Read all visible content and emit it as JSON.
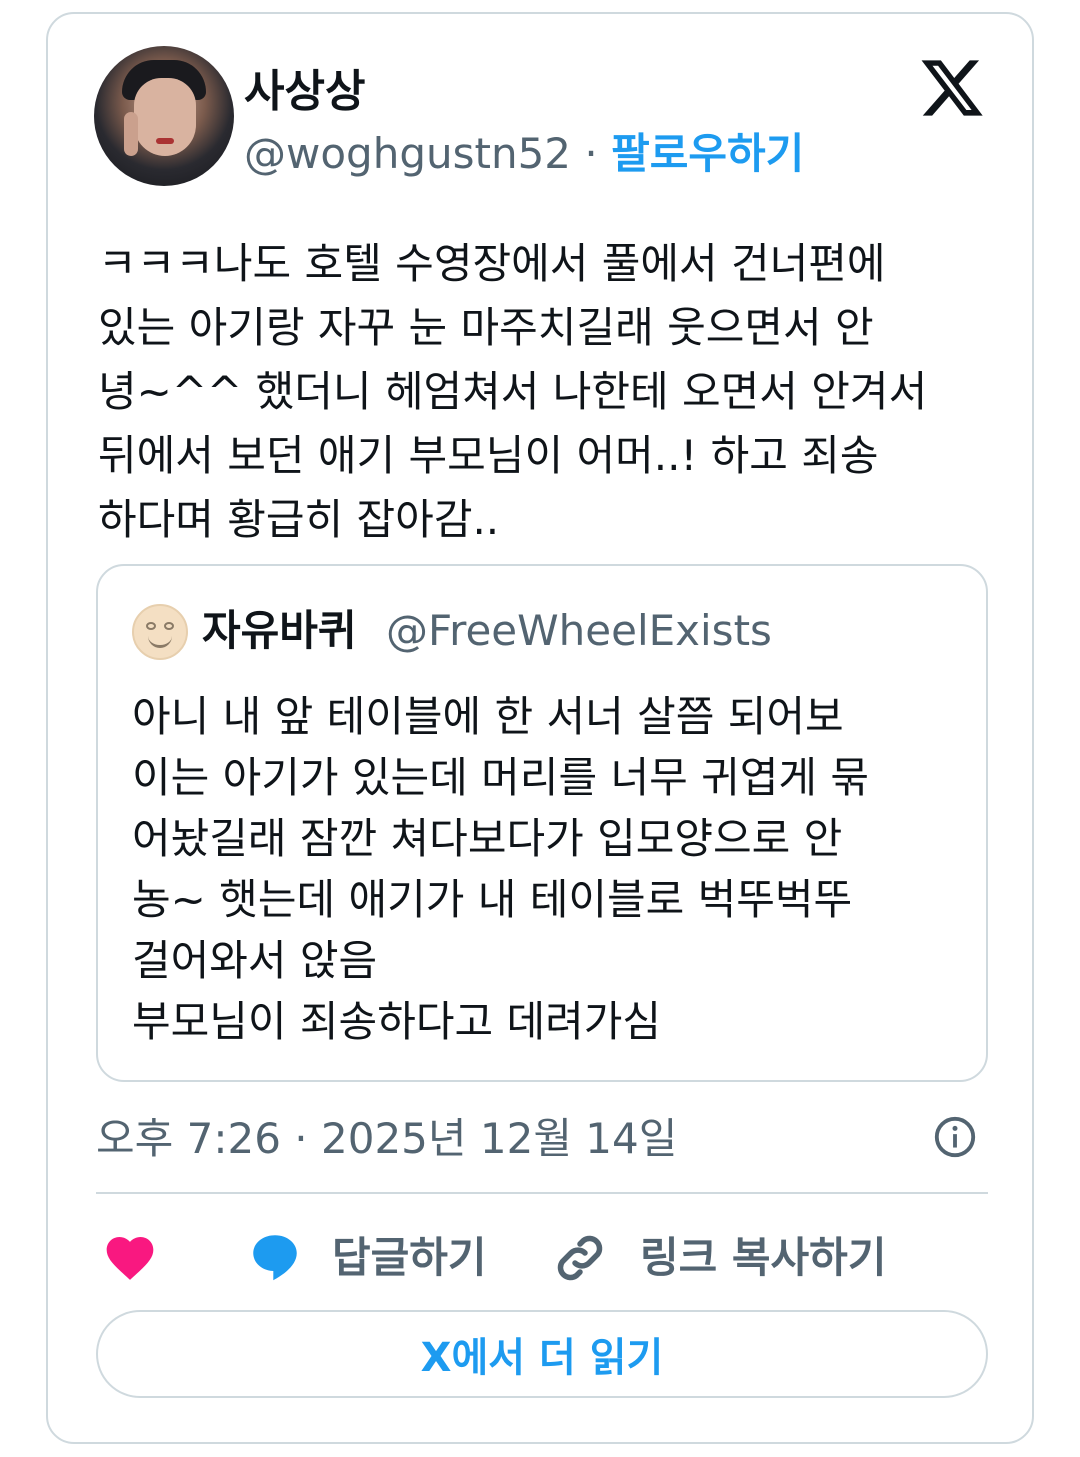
{
  "tweet": {
    "display_name": "사상상",
    "handle": "@woghgustn52",
    "separator": " · ",
    "follow_label": "팔로우하기",
    "text": "ㅋㅋㅋ나도 호텔 수영장에서 풀에서 건너편에\n있는 아기랑 자꾸 눈 마주치길래 웃으면서 안\n녕~^^ 했더니 헤엄쳐서 나한테 오면서 안겨서\n뒤에서 보던 애기 부모님이 어머..! 하고 죄송\n하다며 황급히 잡아감..",
    "timestamp": "오후 7:26 · 2025년 12월 14일"
  },
  "quoted": {
    "display_name": "자유바퀴",
    "handle": "@FreeWheelExists",
    "text": "아니 내 앞 테이블에 한 서너 살쯤 되어보\n이는 아기가 있는데 머리를 너무 귀엽게 묶\n어놨길래 잠깐 쳐다보다가 입모양으로 안\n농~ 햇는데 애기가 내 테이블로 벅뚜벅뚜\n걸어와서 앉음\n부모님이 죄송하다고 데려가심"
  },
  "actions": {
    "reply_label": "답글하기",
    "copy_link_label": "링크 복사하기",
    "read_more_label": "X에서 더 읽기"
  },
  "icons": {
    "logo": "x-logo-icon",
    "info": "info-icon",
    "like": "heart-icon",
    "reply": "speech-bubble-icon",
    "link": "link-icon"
  },
  "colors": {
    "accent": "#1d9bf0",
    "heart": "#f91880",
    "muted": "#536471",
    "border": "#cfd9de"
  }
}
